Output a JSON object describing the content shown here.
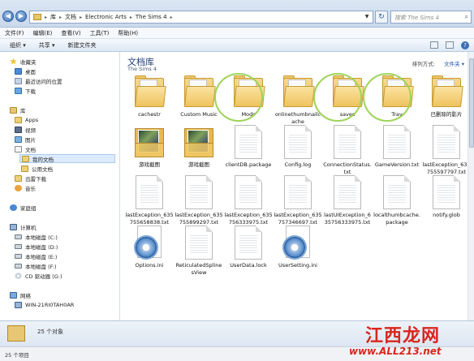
{
  "address": {
    "segments": [
      "库",
      "文档",
      "Electronic Arts",
      "The Sims 4"
    ],
    "search_placeholder": "搜索 The Sims 4"
  },
  "menu": [
    "文件(F)",
    "编辑(E)",
    "查看(V)",
    "工具(T)",
    "帮助(H)"
  ],
  "toolbar": {
    "organize": "组织 ▾",
    "share": "共享 ▾",
    "new_folder": "新建文件夹"
  },
  "nav": {
    "favorites": "收藏夹",
    "desktop": "桌面",
    "recent": "最近访问的位置",
    "downloads": "下载",
    "libraries": "库",
    "apps": "Apps",
    "videos": "视频",
    "pictures": "图片",
    "documents": "文档",
    "my_documents": "我的文档",
    "public_documents": "公用文档",
    "thunder": "迅雷下载",
    "music": "音乐",
    "homegroup": "家庭组",
    "computer": "计算机",
    "drive_c": "本地磁盘 (C:)",
    "drive_d": "本地磁盘 (D:)",
    "drive_e": "本地磁盘 (E:)",
    "drive_f": "本地磁盘 (F:)",
    "drive_g": "CD 驱动器 (G:)",
    "network": "网络",
    "network_pc": "WIN-21RI0TAH0AR"
  },
  "content": {
    "library_title": "文档库",
    "library_subtitle": "The Sims 4",
    "arrange_label": "排列方式:",
    "arrange_value": "文件夹 ▾"
  },
  "items": [
    {
      "label": "cachestr",
      "kind": "folder"
    },
    {
      "label": "Custom Music",
      "kind": "folder"
    },
    {
      "label": "Mods",
      "kind": "folder"
    },
    {
      "label": "onlinethumbnailcache",
      "kind": "folder"
    },
    {
      "label": "saves",
      "kind": "folder"
    },
    {
      "label": "Tray",
      "kind": "folder"
    },
    {
      "label": "已删除的影片",
      "kind": "folder"
    },
    {
      "label": "游戏截图",
      "kind": "thumb"
    },
    {
      "label": "游戏截图",
      "kind": "thumb"
    },
    {
      "label": "clientDB.package",
      "kind": "file"
    },
    {
      "label": "Config.log",
      "kind": "file"
    },
    {
      "label": "ConnectionStatus.txt",
      "kind": "file"
    },
    {
      "label": "GameVersion.txt",
      "kind": "file"
    },
    {
      "label": "lastException_635755597797.txt",
      "kind": "file"
    },
    {
      "label": "lastException_635755658838.txt",
      "kind": "file"
    },
    {
      "label": "lastException_635755899297.txt",
      "kind": "file"
    },
    {
      "label": "lastException_635756333975.txt",
      "kind": "file"
    },
    {
      "label": "lastException_635757346697.txt",
      "kind": "file"
    },
    {
      "label": "lastUIException_635756333975.txt",
      "kind": "file"
    },
    {
      "label": "localthumbcache.package",
      "kind": "file"
    },
    {
      "label": "notify.glob",
      "kind": "file"
    },
    {
      "label": "Options.ini",
      "kind": "gear"
    },
    {
      "label": "ReticulatedSplinesView",
      "kind": "file"
    },
    {
      "label": "UserData.lock",
      "kind": "file"
    },
    {
      "label": "UserSetting.ini",
      "kind": "gear"
    }
  ],
  "details": {
    "count": "25 个对象"
  },
  "status": {
    "count": "25 个项目"
  },
  "watermark": {
    "cn": "江西龙网",
    "url": "www.ALL213.net"
  }
}
